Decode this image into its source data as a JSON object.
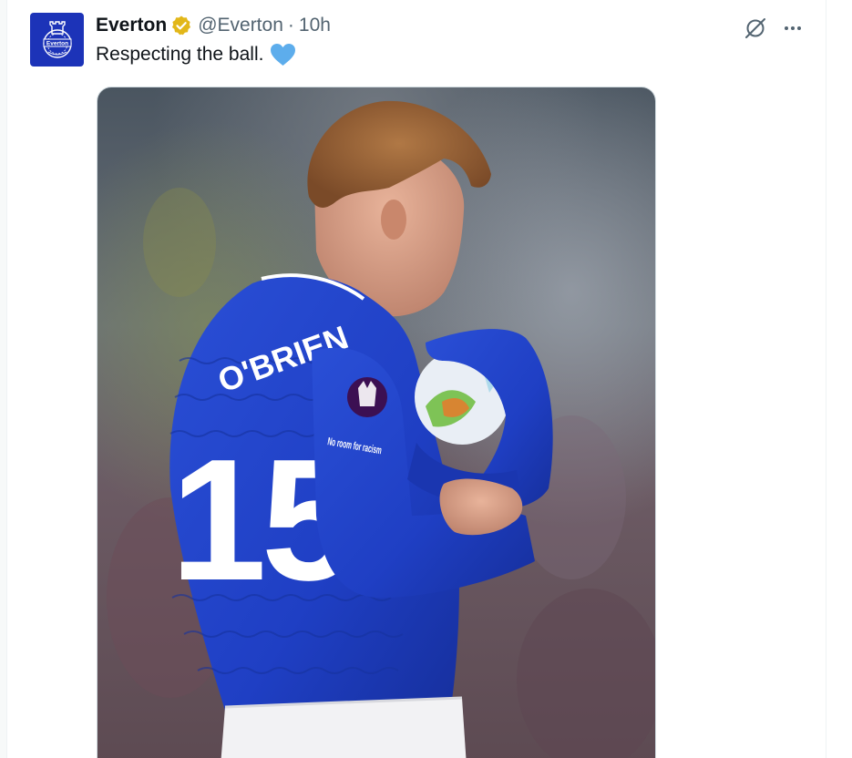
{
  "tweet": {
    "author_name": "Everton",
    "author_handle": "@Everton",
    "separator": "·",
    "time": "10h",
    "text": "Respecting the ball.",
    "emoji": "blue-heart",
    "verified_badge_color": "#e2b719"
  },
  "avatar": {
    "label": "Everton",
    "background": "#1c33b8"
  },
  "media": {
    "shirt_name": "O'BRIEN",
    "shirt_number": "15",
    "sleeve_text": "No room for racism",
    "kit_color": "#1f3fc4"
  },
  "icons": {
    "grok": "grok-icon",
    "more": "more-icon",
    "verified": "verified-badge-icon"
  }
}
